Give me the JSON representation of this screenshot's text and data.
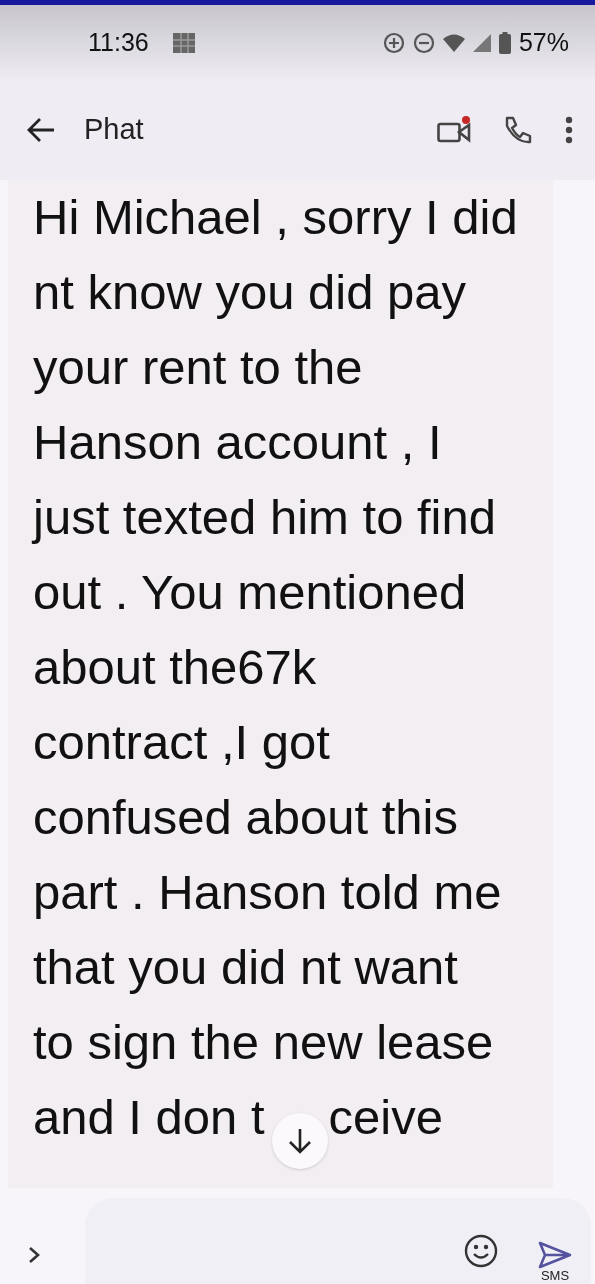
{
  "status_bar": {
    "time": "11:36",
    "battery": "57%"
  },
  "header": {
    "contact": "Phat",
    "video_unread": true
  },
  "message": {
    "lines": [
      "Hi Michael , sorry I did",
      "nt know you did pay",
      "your rent to the",
      "Hanson account , I",
      "just texted him to find",
      "out . You mentioned",
      "about the67k",
      "contract ,I got",
      "confused about this",
      "part . Hanson told me",
      "that you did nt want",
      "to sign the new lease",
      "and I don t"
    ],
    "covered_line_tail": "ceive"
  },
  "compose": {
    "send_label": "SMS"
  }
}
